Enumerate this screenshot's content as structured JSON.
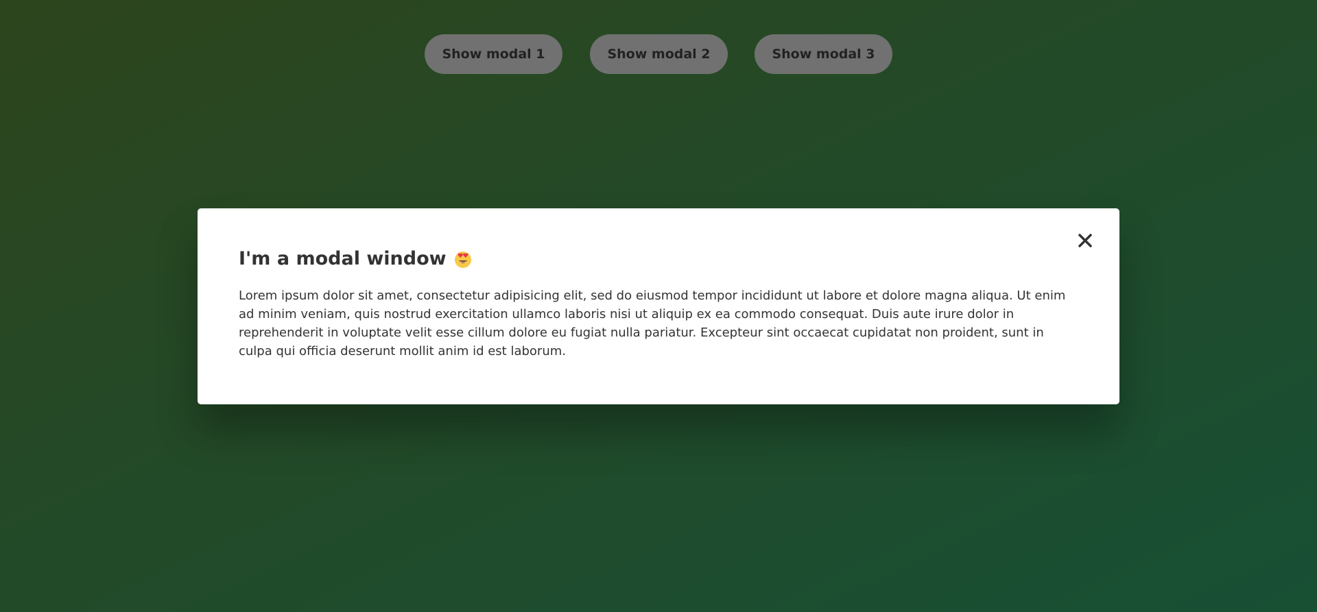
{
  "buttons": [
    {
      "label": "Show modal 1"
    },
    {
      "label": "Show modal 2"
    },
    {
      "label": "Show modal 3"
    }
  ],
  "modal": {
    "title": "I'm a modal window",
    "title_icon": "heart-eyes-emoji-icon",
    "body": "Lorem ipsum dolor sit amet, consectetur adipisicing elit, sed do eiusmod tempor incididunt ut labore et dolore magna aliqua. Ut enim ad minim veniam, quis nostrud exercitation ullamco laboris nisi ut aliquip ex ea commodo consequat. Duis aute irure dolor in reprehenderit in voluptate velit esse cillum dolore eu fugiat nulla pariatur. Excepteur sint occaecat cupidatat non proident, sunt in culpa qui officia deserunt mollit anim id est laborum.",
    "close_icon": "close-icon"
  },
  "colors": {
    "background_gradient_start": "#5a8a3a",
    "background_gradient_end": "#2fa06a",
    "overlay": "rgba(0,0,0,0.5)",
    "modal_background": "#ffffff",
    "text": "#333333",
    "button_background": "#e3e3e3"
  }
}
